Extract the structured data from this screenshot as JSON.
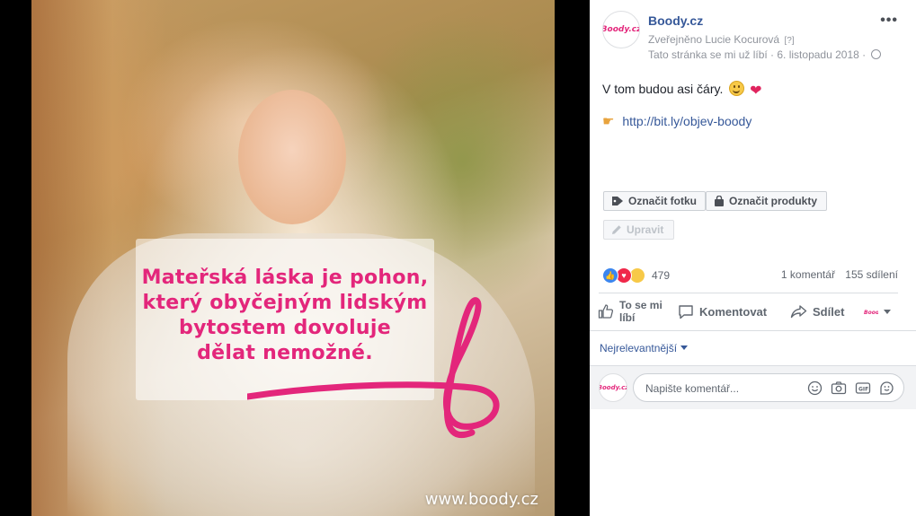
{
  "photo": {
    "quote": "Mateřská láska je pohon,\nkterý obyčejným lidským\nbytostem dovoluje\ndělat nemožné.",
    "watermark": "www.boody.cz"
  },
  "post": {
    "page_name": "Boody.cz",
    "published_by": "Zveřejněno Lucie Kocurová",
    "help_marker": "[?]",
    "meta_line": "Tato stránka se mi už líbí · 6. listopadu 2018 ·",
    "text": "V tom budou asi čáry.",
    "link": "http://bit.ly/objev-boody",
    "avatar_logo": "Boody.cz"
  },
  "buttons": {
    "tag_photo": "Označit fotku",
    "tag_products": "Označit produkty",
    "edit": "Upravit"
  },
  "engagement": {
    "reactions_count": "479",
    "comments": "1 komentář",
    "shares": "155 sdílení"
  },
  "actions": {
    "like": "To se mi\nlíbí",
    "comment": "Komentovat",
    "share": "Sdílet"
  },
  "comments": {
    "sort_label": "Nejrelevantnější",
    "placeholder": "Napište komentář..."
  },
  "colors": {
    "brand_pink": "#e3267b",
    "link_blue": "#365899",
    "meta_gray": "#90949c"
  }
}
